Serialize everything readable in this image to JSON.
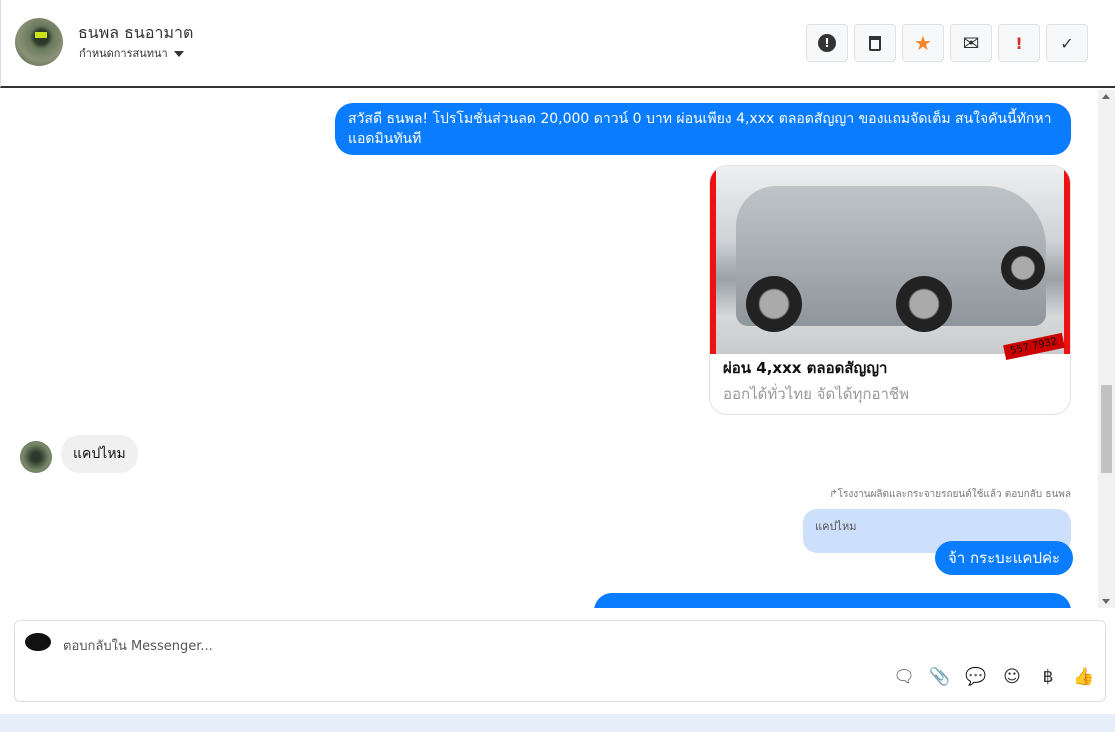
{
  "header": {
    "name": "ธนพล ธนอามาต",
    "subtitle": "กำหนดการสนทนา",
    "actions": [
      {
        "icon": "alert-circle-icon",
        "glyph": "❗"
      },
      {
        "icon": "trash-icon",
        "glyph": "🗑"
      },
      {
        "icon": "star-icon",
        "glyph": "★",
        "color": "#f4862a"
      },
      {
        "icon": "envelope-icon",
        "glyph": "✉"
      },
      {
        "icon": "exclamation-icon",
        "glyph": "!",
        "color": "#d0331f"
      },
      {
        "icon": "check-icon",
        "glyph": "✓"
      }
    ]
  },
  "messages": {
    "promo": "สวัสดี ธนพล! โปรโมชั่นส่วนลด 20,000 ดาวน์ 0 บาท ผ่อนเพียง 4,xxx ตลอดสัญญา ของแถมจัดเต็ม สนใจคันนี้ทักหาแอดมินทันที",
    "card": {
      "title": "ผ่อน 4,xxx ตลอดสัญญา",
      "subtitle": "ออกได้ทั่วไทย จัดได้ทุกอาชีพ",
      "phone": "557 7932"
    },
    "incoming": "แคปไหม",
    "reply_meta": "โรงงานผลิตและกระจายรถยนต์ใช้แล้ว ตอบกลับ ธนพล",
    "quoted": "แคปไหม",
    "reply": "จ้า  กระบะแคปค่ะ"
  },
  "composer": {
    "placeholder": "ตอบกลับใน Messenger...",
    "tools": [
      {
        "icon": "saved-reply-icon",
        "glyph": "⭑"
      },
      {
        "icon": "attachment-icon",
        "glyph": "📎"
      },
      {
        "icon": "chat-bubble-icon",
        "glyph": "💬"
      },
      {
        "icon": "emoji-icon",
        "glyph": "☺"
      },
      {
        "icon": "baht-icon",
        "glyph": "฿"
      },
      {
        "icon": "thumbs-up-icon",
        "glyph": "👍"
      }
    ]
  },
  "colors": {
    "accent": "#0a7cff",
    "quoted": "#cce0fb"
  }
}
